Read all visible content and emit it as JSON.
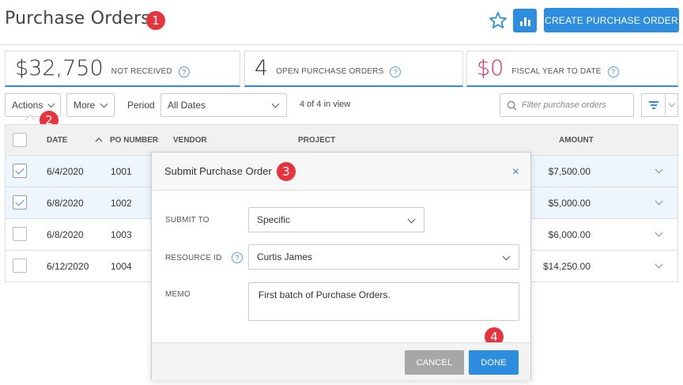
{
  "header": {
    "title": "Purchase Orders",
    "create_label": "CREATE PURCHASE ORDER"
  },
  "badges": {
    "b1": "1",
    "b2": "2",
    "b3": "3",
    "b4": "4"
  },
  "stats": [
    {
      "value": "$32,750",
      "label": "NOT RECEIVED"
    },
    {
      "value": "4",
      "label": "OPEN PURCHASE ORDERS"
    },
    {
      "value": "$0",
      "label": "FISCAL YEAR TO DATE"
    }
  ],
  "help_glyph": "?",
  "toolbar": {
    "actions_label": "Actions",
    "more_label": "More",
    "period_label": "Period",
    "period_value": "All Dates",
    "count_text": "4 of 4 in view",
    "filter_placeholder": "Filter purchase orders"
  },
  "table": {
    "columns": {
      "date": "DATE",
      "po": "PO NUMBER",
      "vendor": "VENDOR",
      "project": "PROJECT",
      "amount": "AMOUNT"
    },
    "rows": [
      {
        "date": "6/4/2020",
        "po": "1001",
        "amount": "$7,500.00",
        "checked": true
      },
      {
        "date": "6/8/2020",
        "po": "1002",
        "amount": "$5,000.00",
        "checked": true
      },
      {
        "date": "6/8/2020",
        "po": "1003",
        "amount": "$6,000.00",
        "checked": false
      },
      {
        "date": "6/12/2020",
        "po": "1004",
        "amount": "$14,250.00",
        "checked": false
      }
    ]
  },
  "modal": {
    "title": "Submit Purchase Order",
    "close_glyph": "×",
    "submit_to_label": "SUBMIT TO",
    "submit_to_value": "Specific",
    "resource_label": "RESOURCE ID",
    "resource_value": "Curtis James",
    "memo_label": "MEMO",
    "memo_value": "First batch of Purchase Orders.",
    "cancel_label": "CANCEL",
    "done_label": "DONE"
  },
  "colors": {
    "accent": "#2d8ee0",
    "badge": "#e5343d",
    "negative": "#d9305d"
  }
}
